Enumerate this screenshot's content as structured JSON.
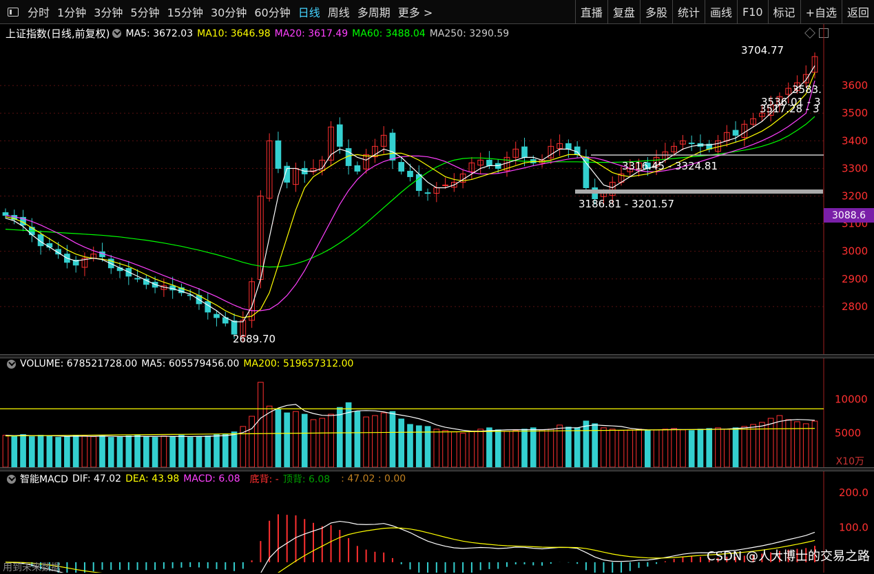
{
  "toolbar": {
    "periods": [
      "分时",
      "1分钟",
      "3分钟",
      "5分钟",
      "15分钟",
      "30分钟",
      "60分钟",
      "日线",
      "周线",
      "多周期",
      "更多 >"
    ],
    "active_period": "日线",
    "right_buttons": [
      "直播",
      "复盘",
      "多股",
      "统计",
      "画线",
      "F10",
      "标记",
      "+自选",
      "返回"
    ]
  },
  "price_panel": {
    "title": "上证指数(日线,前复权)",
    "ma5": "MA5: 3672.03",
    "ma10": "MA10: 3646.98",
    "ma20": "MA20: 3617.49",
    "ma60": "MA60: 3488.04",
    "ma250": "MA250: 3290.59",
    "y_ticks": [
      "3600",
      "3500",
      "3400",
      "3300",
      "3200",
      "3100",
      "3000",
      "2900",
      "2800"
    ],
    "current_price_tag": "3088.6",
    "annotations": {
      "high": "3704.77",
      "low": "2689.70",
      "range1": "3316.45 - 3324.81",
      "range2": "3186.81 - 3201.57",
      "partial1": "3583.",
      "partial2": "3536.01 - 3",
      "partial3": "3517.28 - 3"
    }
  },
  "volume_panel": {
    "volume": "VOLUME: 678521728.00",
    "ma5": "MA5: 605579456.00",
    "ma200": "MA200: 519657312.00",
    "y_ticks": [
      "10000",
      "5000"
    ],
    "unit": "X10万"
  },
  "macd_panel": {
    "name": "智能MACD",
    "dif": "DIF: 47.02",
    "dea": "DEA: 43.98",
    "macd": "MACD: 6.08",
    "bottom_div": "底背: -",
    "top_div": "顶背: 6.08",
    "extra": ": 47.02 : 0.00",
    "y_ticks": [
      "200.0",
      "100.0"
    ]
  },
  "footer": {
    "bottom_label": "用到未来数据",
    "watermark": "CSDN @人大博士的交易之路"
  },
  "colors": {
    "ma5": "#ffffff",
    "ma10": "#ffff00",
    "ma20": "#ff40ff",
    "ma60": "#00ff00",
    "ma250": "#cccccc",
    "up": "#ff3030",
    "down": "#34d0d0",
    "active": "#45d4ff",
    "tag": "#7a1fa8"
  },
  "chart_data": {
    "type": "candlestick",
    "ylim": [
      2650,
      3760
    ],
    "close": [
      3130,
      3115,
      3095,
      3060,
      3020,
      3015,
      2990,
      2960,
      2950,
      2975,
      2990,
      2980,
      2940,
      2930,
      2910,
      2900,
      2880,
      2870,
      2875,
      2860,
      2850,
      2840,
      2810,
      2780,
      2760,
      2740,
      2700,
      2750,
      2890,
      3200,
      3400,
      3300,
      3250,
      3300,
      3280,
      3300,
      3330,
      3450,
      3380,
      3310,
      3290,
      3350,
      3380,
      3420,
      3330,
      3290,
      3270,
      3220,
      3210,
      3230,
      3240,
      3250,
      3280,
      3320,
      3330,
      3310,
      3300,
      3340,
      3370,
      3340,
      3320,
      3330,
      3380,
      3390,
      3370,
      3350,
      3230,
      3190,
      3210,
      3250,
      3280,
      3300,
      3320,
      3300,
      3340,
      3360,
      3380,
      3400,
      3390,
      3380,
      3370,
      3400,
      3430,
      3420,
      3460,
      3480,
      3500,
      3530,
      3560,
      3590,
      3610,
      3640,
      3704.77
    ],
    "ma5": [
      3120,
      3110,
      3090,
      3060,
      3035,
      3015,
      2995,
      2975,
      2965,
      2970,
      2975,
      2970,
      2955,
      2940,
      2925,
      2910,
      2895,
      2880,
      2870,
      2865,
      2855,
      2845,
      2825,
      2805,
      2785,
      2760,
      2745,
      2745,
      2800,
      2900,
      3050,
      3200,
      3300,
      3300,
      3290,
      3290,
      3300,
      3350,
      3370,
      3360,
      3340,
      3330,
      3350,
      3370,
      3360,
      3340,
      3310,
      3280,
      3250,
      3230,
      3230,
      3240,
      3260,
      3280,
      3300,
      3310,
      3310,
      3320,
      3330,
      3340,
      3340,
      3330,
      3350,
      3370,
      3370,
      3360,
      3320,
      3280,
      3240,
      3230,
      3250,
      3270,
      3290,
      3300,
      3310,
      3330,
      3350,
      3370,
      3380,
      3385,
      3385,
      3390,
      3400,
      3410,
      3430,
      3450,
      3470,
      3500,
      3530,
      3560,
      3590,
      3620,
      3672.03
    ],
    "ma10": [
      3125,
      3118,
      3105,
      3085,
      3065,
      3045,
      3025,
      3005,
      2990,
      2980,
      2975,
      2972,
      2965,
      2955,
      2945,
      2930,
      2915,
      2900,
      2888,
      2878,
      2866,
      2855,
      2840,
      2822,
      2805,
      2785,
      2770,
      2760,
      2765,
      2790,
      2850,
      2950,
      3050,
      3150,
      3230,
      3270,
      3290,
      3310,
      3330,
      3345,
      3350,
      3345,
      3345,
      3350,
      3355,
      3355,
      3345,
      3330,
      3310,
      3290,
      3270,
      3260,
      3255,
      3260,
      3270,
      3280,
      3290,
      3300,
      3310,
      3320,
      3325,
      3325,
      3330,
      3340,
      3350,
      3350,
      3340,
      3325,
      3305,
      3285,
      3275,
      3270,
      3275,
      3280,
      3290,
      3300,
      3315,
      3330,
      3345,
      3360,
      3370,
      3378,
      3385,
      3395,
      3405,
      3420,
      3435,
      3455,
      3480,
      3505,
      3535,
      3570,
      3646.98
    ],
    "ma20": [
      3130,
      3125,
      3118,
      3108,
      3095,
      3080,
      3065,
      3048,
      3030,
      3015,
      3002,
      2992,
      2982,
      2972,
      2962,
      2950,
      2938,
      2925,
      2912,
      2900,
      2888,
      2876,
      2864,
      2850,
      2836,
      2820,
      2805,
      2792,
      2785,
      2785,
      2790,
      2810,
      2840,
      2880,
      2930,
      2990,
      3050,
      3110,
      3170,
      3220,
      3260,
      3290,
      3310,
      3325,
      3335,
      3342,
      3345,
      3345,
      3342,
      3335,
      3325,
      3310,
      3295,
      3285,
      3280,
      3280,
      3282,
      3288,
      3295,
      3302,
      3310,
      3316,
      3322,
      3328,
      3334,
      3338,
      3340,
      3338,
      3330,
      3320,
      3310,
      3300,
      3292,
      3288,
      3288,
      3292,
      3298,
      3306,
      3315,
      3325,
      3335,
      3345,
      3355,
      3365,
      3375,
      3387,
      3400,
      3415,
      3432,
      3452,
      3475,
      3500,
      3617.49
    ],
    "ma60": [
      3080,
      3078,
      3076,
      3074,
      3072,
      3070,
      3068,
      3066,
      3064,
      3062,
      3060,
      3058,
      3055,
      3052,
      3048,
      3044,
      3040,
      3035,
      3030,
      3024,
      3018,
      3011,
      3004,
      2996,
      2988,
      2979,
      2970,
      2960,
      2952,
      2946,
      2943,
      2944,
      2948,
      2955,
      2965,
      2978,
      2993,
      3010,
      3030,
      3052,
      3076,
      3102,
      3130,
      3158,
      3186,
      3214,
      3240,
      3264,
      3286,
      3305,
      3320,
      3330,
      3336,
      3338,
      3338,
      3336,
      3333,
      3330,
      3328,
      3326,
      3325,
      3324,
      3324,
      3324,
      3324,
      3324,
      3323,
      3322,
      3322,
      3322,
      3323,
      3324,
      3326,
      3328,
      3330,
      3333,
      3336,
      3339,
      3342,
      3345,
      3348,
      3352,
      3356,
      3361,
      3366,
      3372,
      3380,
      3390,
      3402,
      3418,
      3438,
      3460,
      3488.04
    ],
    "volume": [
      4700,
      4600,
      4800,
      4500,
      4700,
      4600,
      4400,
      4500,
      4700,
      4600,
      4500,
      4600,
      4400,
      4500,
      4600,
      4700,
      4500,
      4400,
      4600,
      4500,
      4700,
      4400,
      4500,
      4600,
      4800,
      4900,
      5200,
      6000,
      7500,
      12500,
      9000,
      8500,
      8000,
      8200,
      7800,
      7000,
      7200,
      7800,
      8800,
      9500,
      8200,
      7400,
      7600,
      8000,
      8200,
      7100,
      6300,
      6100,
      6000,
      5600,
      5400,
      5200,
      5000,
      5300,
      5600,
      5800,
      5500,
      5300,
      5400,
      5600,
      5800,
      5500,
      5600,
      6200,
      5900,
      5800,
      6800,
      6400,
      5800,
      5600,
      5400,
      5500,
      5600,
      5400,
      5500,
      5600,
      5700,
      5500,
      5400,
      5600,
      5700,
      5800,
      5600,
      5800,
      6000,
      6300,
      6600,
      7200,
      7600,
      7000,
      6700,
      6400,
      6785
    ]
  }
}
